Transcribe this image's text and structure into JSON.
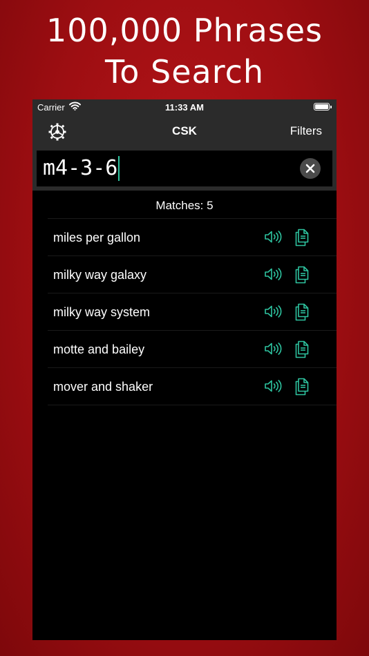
{
  "promo": {
    "line1": "100,000 Phrases",
    "line2": "To Search"
  },
  "status_bar": {
    "carrier": "Carrier",
    "time": "11:33 AM"
  },
  "nav": {
    "title": "CSK",
    "filters_label": "Filters",
    "settings_icon": "gear-icon"
  },
  "search": {
    "value": "m4-3-6"
  },
  "results": {
    "matches_label": "Matches: 5",
    "items": [
      {
        "phrase": "miles per gallon"
      },
      {
        "phrase": "milky way galaxy"
      },
      {
        "phrase": "milky way system"
      },
      {
        "phrase": "motte and bailey"
      },
      {
        "phrase": "mover and shaker"
      }
    ]
  },
  "colors": {
    "accent": "#2ec4a0",
    "background": "#a80f13",
    "bar": "#2b2b2b"
  }
}
